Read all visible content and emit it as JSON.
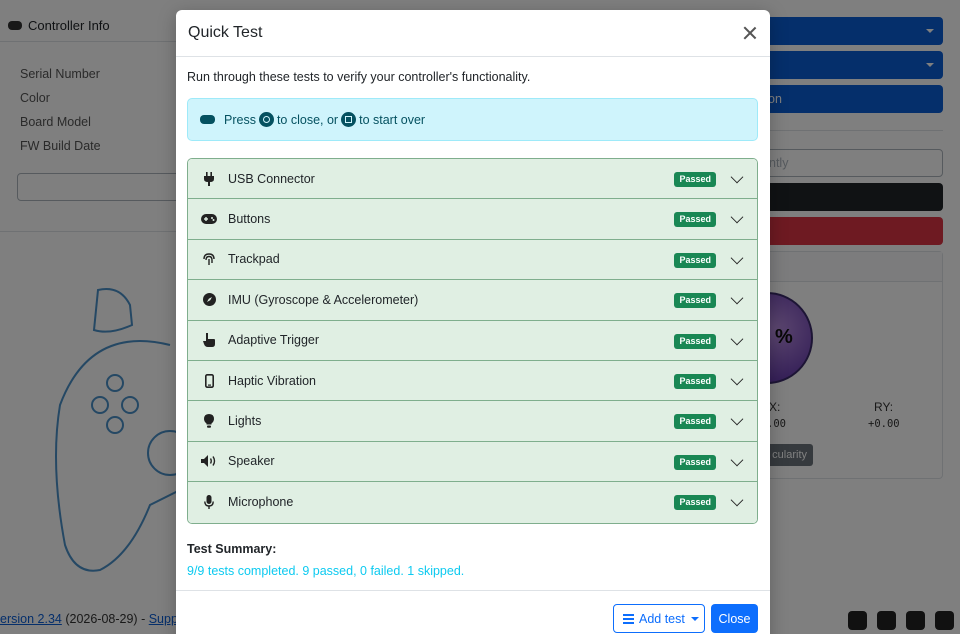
{
  "background": {
    "card_title": "Controller Info",
    "info_labels": [
      "Serial Number",
      "Color",
      "Board Model",
      "FW Build Date"
    ],
    "right_button_label": "on",
    "outline_button_label": "ntly",
    "gauge_percent": "%",
    "axis_x_label": "X:",
    "axis_x_value": ".00",
    "axis_ry_label": "RY:",
    "axis_ry_value": "+0.00",
    "circularity_button": "cularity",
    "footer_version_link": "ersion 2.34",
    "footer_date": " (2026-08-29) - ",
    "footer_support_link": "Suppo"
  },
  "modal": {
    "title": "Quick Test",
    "intro": "Run through these tests to verify your controller's functionality.",
    "alert": {
      "press": "Press",
      "to_close": "to close, or",
      "to_start_over": "to start over"
    },
    "tests": [
      {
        "label": "USB Connector",
        "status": "Passed",
        "icon": "plug-icon"
      },
      {
        "label": "Buttons",
        "status": "Passed",
        "icon": "gamepad-icon"
      },
      {
        "label": "Trackpad",
        "status": "Passed",
        "icon": "fingerprint-icon"
      },
      {
        "label": "IMU (Gyroscope & Accelerometer)",
        "status": "Passed",
        "icon": "compass-icon"
      },
      {
        "label": "Adaptive Trigger",
        "status": "Passed",
        "icon": "hand-pointer-icon"
      },
      {
        "label": "Haptic Vibration",
        "status": "Passed",
        "icon": "mobile-icon"
      },
      {
        "label": "Lights",
        "status": "Passed",
        "icon": "lightbulb-icon"
      },
      {
        "label": "Speaker",
        "status": "Passed",
        "icon": "volume-icon"
      },
      {
        "label": "Microphone",
        "status": "Passed",
        "icon": "microphone-icon"
      }
    ],
    "summary_title": "Test Summary:",
    "summary_text": "9/9 tests completed. 9 passed, 0 failed. 1 skipped.",
    "add_test_label": "Add test",
    "close_label": "Close"
  },
  "colors": {
    "accordion_bg": "#e0efe3",
    "badge_success": "#198754",
    "primary": "#0d6efd",
    "alert_info_bg": "#cff4fc",
    "summary_info_text": "#0dcaf0"
  }
}
